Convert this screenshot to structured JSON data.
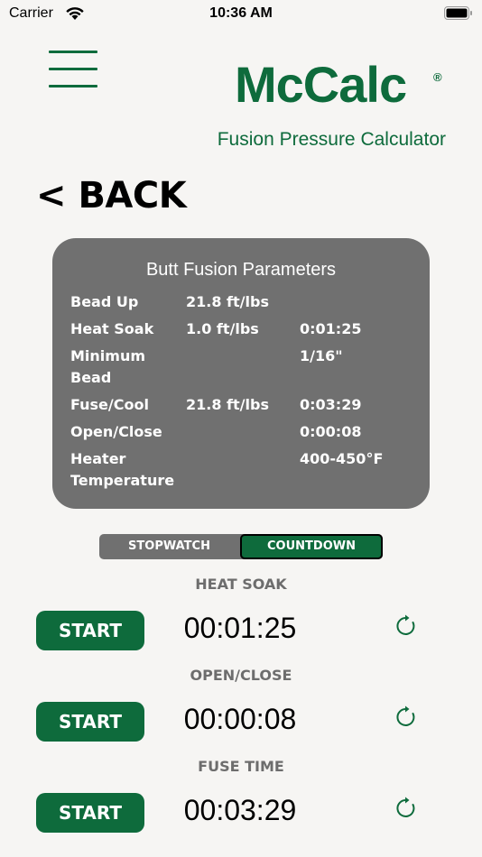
{
  "status_bar": {
    "carrier": "Carrier",
    "time": "10:36 AM"
  },
  "header": {
    "logo": "McCalc",
    "logo_mark": "®",
    "subtitle": "Fusion Pressure Calculator",
    "menu_icon": "hamburger-menu-icon"
  },
  "nav": {
    "back_label": "< BACK"
  },
  "parameters": {
    "title": "Butt Fusion Parameters",
    "rows": [
      {
        "label": "Bead Up",
        "pressure": "21.8 ft/lbs",
        "time": ""
      },
      {
        "label": "Heat Soak",
        "pressure": "1.0 ft/lbs",
        "time": "0:01:25"
      },
      {
        "label": "Minimum Bead",
        "pressure": "",
        "time": "1/16\""
      },
      {
        "label": "Fuse/Cool",
        "pressure": "21.8 ft/lbs",
        "time": "0:03:29"
      },
      {
        "label": "Open/Close",
        "pressure": "",
        "time": "0:00:08"
      },
      {
        "label": "Heater Temperature",
        "pressure": "",
        "time": "400-450°F"
      }
    ]
  },
  "mode": {
    "options": [
      "STOPWATCH",
      "COUNTDOWN"
    ],
    "selected": "COUNTDOWN"
  },
  "timers": [
    {
      "label": "HEAT SOAK",
      "button": "START",
      "value": "00:01:25",
      "reset_icon": "reset-icon"
    },
    {
      "label": "OPEN/CLOSE",
      "button": "START",
      "value": "00:00:08",
      "reset_icon": "reset-icon"
    },
    {
      "label": "FUSE TIME",
      "button": "START",
      "value": "00:03:29",
      "reset_icon": "reset-icon"
    }
  ],
  "colors": {
    "brand_green": "#0e6b3c",
    "card_gray": "#707070",
    "background": "#f6f5f3"
  }
}
